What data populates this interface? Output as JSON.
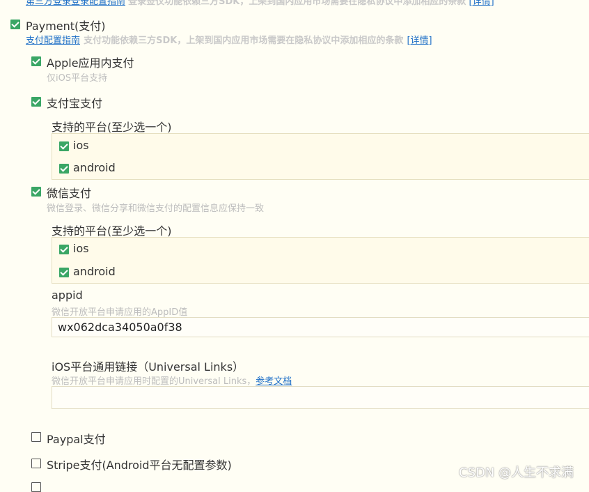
{
  "top_cut": {
    "link": "第三方登录登录配置指南",
    "text": "登录签仅功能依赖三方SDK，上架到国内应用市场需要在隐私协议中添加相应的条款",
    "detail": "[详情]"
  },
  "payment": {
    "label": "Payment(支付)",
    "checked": true,
    "guide_link": "支付配置指南",
    "notice": "支付功能依赖三方SDK，上架到国内应用市场需要在隐私协议中添加相应的条款",
    "detail_link": "[详情]",
    "apple": {
      "label": "Apple应用内支付",
      "checked": true,
      "desc": "仅iOS平台支持"
    },
    "alipay": {
      "label": "支付宝支付",
      "checked": true,
      "platform_title": "支持的平台(至少选一个)",
      "platforms": [
        {
          "label": "ios",
          "checked": true
        },
        {
          "label": "android",
          "checked": true
        }
      ]
    },
    "wechat": {
      "label": "微信支付",
      "checked": true,
      "desc": "微信登录、微信分享和微信支付的配置信息应保持一致",
      "platform_title": "支持的平台(至少选一个)",
      "platforms": [
        {
          "label": "ios",
          "checked": true
        },
        {
          "label": "android",
          "checked": true
        }
      ],
      "appid": {
        "label": "appid",
        "desc": "微信开放平台申请应用的AppID值",
        "value": "wx062dca34050a0f38"
      },
      "universal_links": {
        "label": "iOS平台通用链接（Universal Links）",
        "desc": "微信开放平台申请应用时配置的Universal Links，",
        "doc_link": "参考文档",
        "value": ""
      }
    },
    "paypal": {
      "label": "Paypal支付",
      "checked": false
    },
    "stripe": {
      "label": "Stripe支付(Android平台无配置参数)",
      "checked": false
    }
  },
  "watermark": "CSDN @人生不求满",
  "colors": {
    "background": "#fffef4",
    "checkbox_checked": "#3aa665",
    "link": "#1e6fc7"
  }
}
